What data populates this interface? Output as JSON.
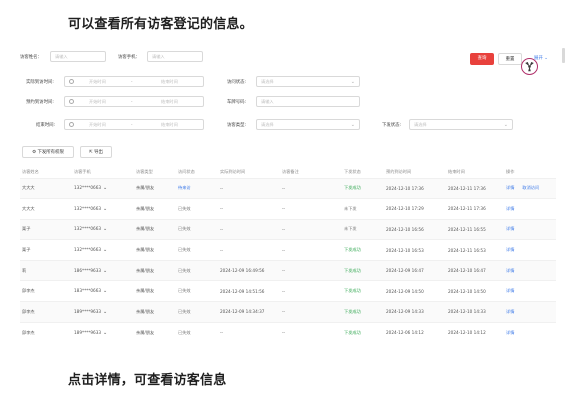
{
  "captions": {
    "top": "可以查看所有访客登记的信息。",
    "bottom": "点击详情，可查看访客信息"
  },
  "filters": {
    "visitor_name_label": "访客姓名：",
    "visitor_name_placeholder": "请输入",
    "visitor_phone_label": "访客手机：",
    "visitor_phone_placeholder": "请输入",
    "actual_visit_time_label": "实际到访时间:",
    "visit_status_label": "访问状态:",
    "expected_visit_time_label": "预约到访时间:",
    "plate_label": "车牌号码:",
    "end_time_label": "结束时间:",
    "visitor_type_label": "访客类型:",
    "issue_status_label": "下发状态:",
    "start_time_placeholder": "开始时间",
    "end_time_placeholder": "结束时间",
    "range_separator": "-",
    "select_placeholder": "请选择",
    "input_placeholder": "请输入"
  },
  "buttons": {
    "query": "查询",
    "reset": "重置",
    "expand": "展开",
    "issue_all": "下发所有权限",
    "export": "导出"
  },
  "table": {
    "columns": [
      "访客姓名",
      "访客手机",
      "访客类型",
      "访问状态",
      "实际到访时间",
      "访客备注",
      "下发状态",
      "预约到访时间",
      "结束时间",
      "操作"
    ],
    "rows": [
      {
        "name": "大大大",
        "phone": "132****0663",
        "type": "亲属/朋友",
        "status": "待来访",
        "actual": "--",
        "note": "--",
        "issue": "下发成功",
        "expected": "2024-12-10 17:36",
        "end": "2024-12-11 17:36",
        "action1": "详情",
        "action2": "取消访问"
      },
      {
        "name": "大大大",
        "phone": "132****0663",
        "type": "亲属/朋友",
        "status": "已失效",
        "actual": "--",
        "note": "--",
        "issue": "未下发",
        "expected": "2024-12-10 17:29",
        "end": "2024-12-11 17:36",
        "action1": "详情",
        "action2": ""
      },
      {
        "name": "栗子",
        "phone": "132****0663",
        "type": "亲属/朋友",
        "status": "已失效",
        "actual": "--",
        "note": "--",
        "issue": "未下发",
        "expected": "2024-12-10 16:56",
        "end": "2024-12-11 16:55",
        "action1": "详情",
        "action2": ""
      },
      {
        "name": "栗子",
        "phone": "132****0663",
        "type": "亲属/朋友",
        "status": "已失效",
        "actual": "--",
        "note": "--",
        "issue": "下发成功",
        "expected": "2024-12-10 16:53",
        "end": "2024-12-11 16:53",
        "action1": "详情",
        "action2": ""
      },
      {
        "name": "莉",
        "phone": "186****9633",
        "type": "亲属/朋友",
        "status": "已失效",
        "actual": "2024-12-09 16:49:56",
        "note": "--",
        "issue": "下发成功",
        "expected": "2024-12-09 16:47",
        "end": "2024-12-10 16:47",
        "action1": "详情",
        "action2": ""
      },
      {
        "name": "邱李杰",
        "phone": "183****0663",
        "type": "亲属/朋友",
        "status": "已失效",
        "actual": "2024-12-09 14:51:56",
        "note": "--",
        "issue": "下发成功",
        "expected": "2024-12-09 14:50",
        "end": "2024-12-10 14:50",
        "action1": "详情",
        "action2": ""
      },
      {
        "name": "邱李杰",
        "phone": "189****9633",
        "type": "亲属/朋友",
        "status": "已失效",
        "actual": "2024-12-09 14:34:37",
        "note": "--",
        "issue": "下发成功",
        "expected": "2024-12-09 14:33",
        "end": "2024-12-10 14:33",
        "action1": "详情",
        "action2": ""
      },
      {
        "name": "邱李杰",
        "phone": "189****9633",
        "type": "亲属/朋友",
        "status": "已失效",
        "actual": "--",
        "note": "--",
        "issue": "下发成功",
        "expected": "2024-12-06 14:12",
        "end": "2024-12-10 14:12",
        "action1": "详情",
        "action2": ""
      }
    ]
  },
  "colors": {
    "accent_red": "#e8413c",
    "link_blue": "#3a78e8",
    "success_green": "#34a853"
  }
}
